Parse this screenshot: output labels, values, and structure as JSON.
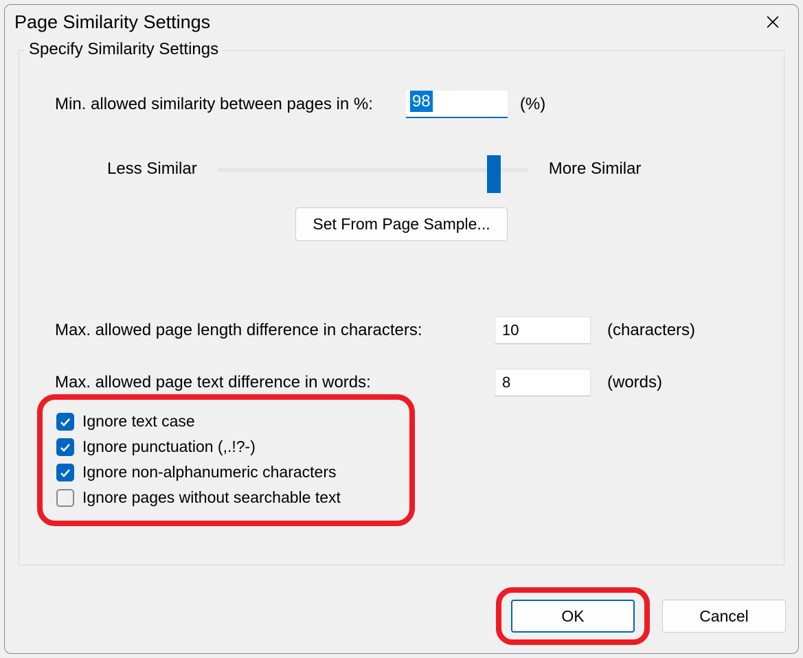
{
  "dialog": {
    "title": "Page Similarity Settings"
  },
  "group": {
    "legend": "Specify Similarity Settings",
    "min_similarity_label": "Min. allowed similarity between pages in %:",
    "min_similarity_value": "98",
    "min_similarity_unit": "(%)",
    "slider_left": "Less Similar",
    "slider_right": "More Similar",
    "sample_button": "Set From Page Sample...",
    "max_len_label": "Max. allowed page length difference in characters:",
    "max_len_value": "10",
    "max_len_unit": "(characters)",
    "max_words_label": "Max. allowed page text difference in words:",
    "max_words_value": "8",
    "max_words_unit": "(words)"
  },
  "checks": {
    "ignore_case": {
      "label": "Ignore text case",
      "checked": true
    },
    "ignore_punct": {
      "label": "Ignore punctuation (,.!?-)",
      "checked": true
    },
    "ignore_nonalnum": {
      "label": "Ignore non-alphanumeric characters",
      "checked": true
    },
    "ignore_nosearch": {
      "label": "Ignore pages without searchable text",
      "checked": false
    }
  },
  "buttons": {
    "ok": "OK",
    "cancel": "Cancel"
  }
}
